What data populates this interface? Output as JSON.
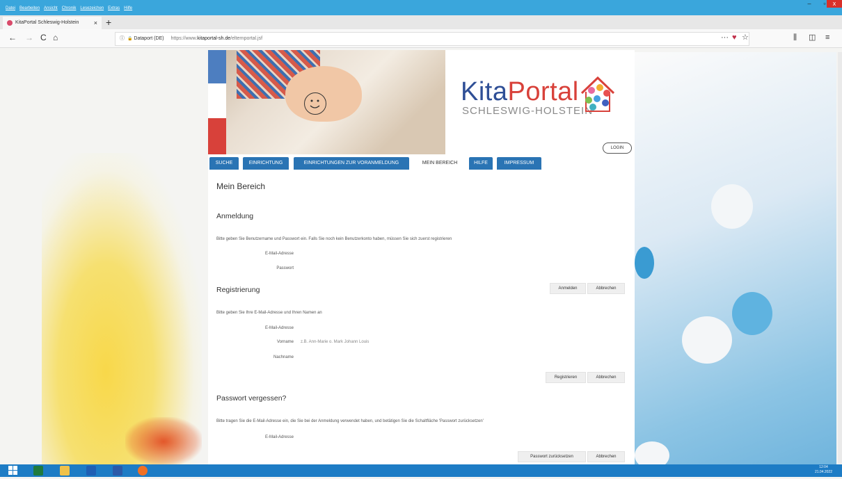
{
  "browser": {
    "menu": [
      "Datei",
      "Bearbeiten",
      "Ansicht",
      "Chronik",
      "Lesezeichen",
      "Extras",
      "Hilfe"
    ],
    "tab_title": "KitaPortal Schleswig-Holstein",
    "tab_close": "×",
    "new_tab": "+",
    "back": "←",
    "forward": "→",
    "reload": "C",
    "home": "⌂",
    "site_info": "ⓘ",
    "lock": "🔒",
    "org": "Dataport (DE)",
    "url_prefix": "https://www.",
    "url_domain": "kitaportal-sh.de",
    "url_path": "/elternportal.jsf",
    "page_actions": "···",
    "pocket": "♥",
    "bookmark": "☆",
    "library": "⫼",
    "sidebar": "◫",
    "menu_icon": "≡",
    "win_min": "–",
    "win_max": "▫",
    "win_close": "x"
  },
  "header": {
    "logo_kita": "Kita",
    "logo_portal": "Portal",
    "logo_sub": "SCHLESWIG-HOLSTEIN",
    "login": "LOGIN"
  },
  "nav": {
    "tabs": [
      "SUCHE",
      "EINRICHTUNG",
      "EINRICHTUNGEN ZUR VORANMELDUNG",
      "MEIN BEREICH",
      "HILFE",
      "IMPRESSUM"
    ],
    "active": "MEIN BEREICH"
  },
  "page": {
    "title": "Mein Bereich",
    "login_section": {
      "heading": "Anmeldung",
      "hint": "Bitte geben Sie Benutzername und Passwort ein. Falls Sie noch kein Benutzerkonto haben, müssen Sie sich zuerst registrieren",
      "email_label": "E-Mail-Adresse",
      "password_label": "Passwort",
      "submit": "Anmelden",
      "cancel": "Abbrechen"
    },
    "register_section": {
      "heading": "Registrierung",
      "hint": "Bitte geben Sie Ihre E-Mail-Adresse und Ihren Namen an",
      "email_label": "E-Mail-Adresse",
      "firstname_label": "Vorname",
      "firstname_placeholder": "z.B. Ann-Marie o. Mark Johann Louis",
      "lastname_label": "Nachname",
      "submit": "Registrieren",
      "cancel": "Abbrechen"
    },
    "forgot_section": {
      "heading": "Passwort vergessen?",
      "hint": "Bitte tragen Sie die E-Mail-Adresse ein, die Sie bei der Anmeldung verwendet haben, und betätigen Sie die Schaltfläche 'Passwort zurücksetzen'",
      "email_label": "E-Mail-Adresse",
      "submit": "Passwort zurücksetzen",
      "cancel": "Abbrechen"
    }
  },
  "taskbar": {
    "time": "12:04",
    "date": "21.04.2022"
  }
}
